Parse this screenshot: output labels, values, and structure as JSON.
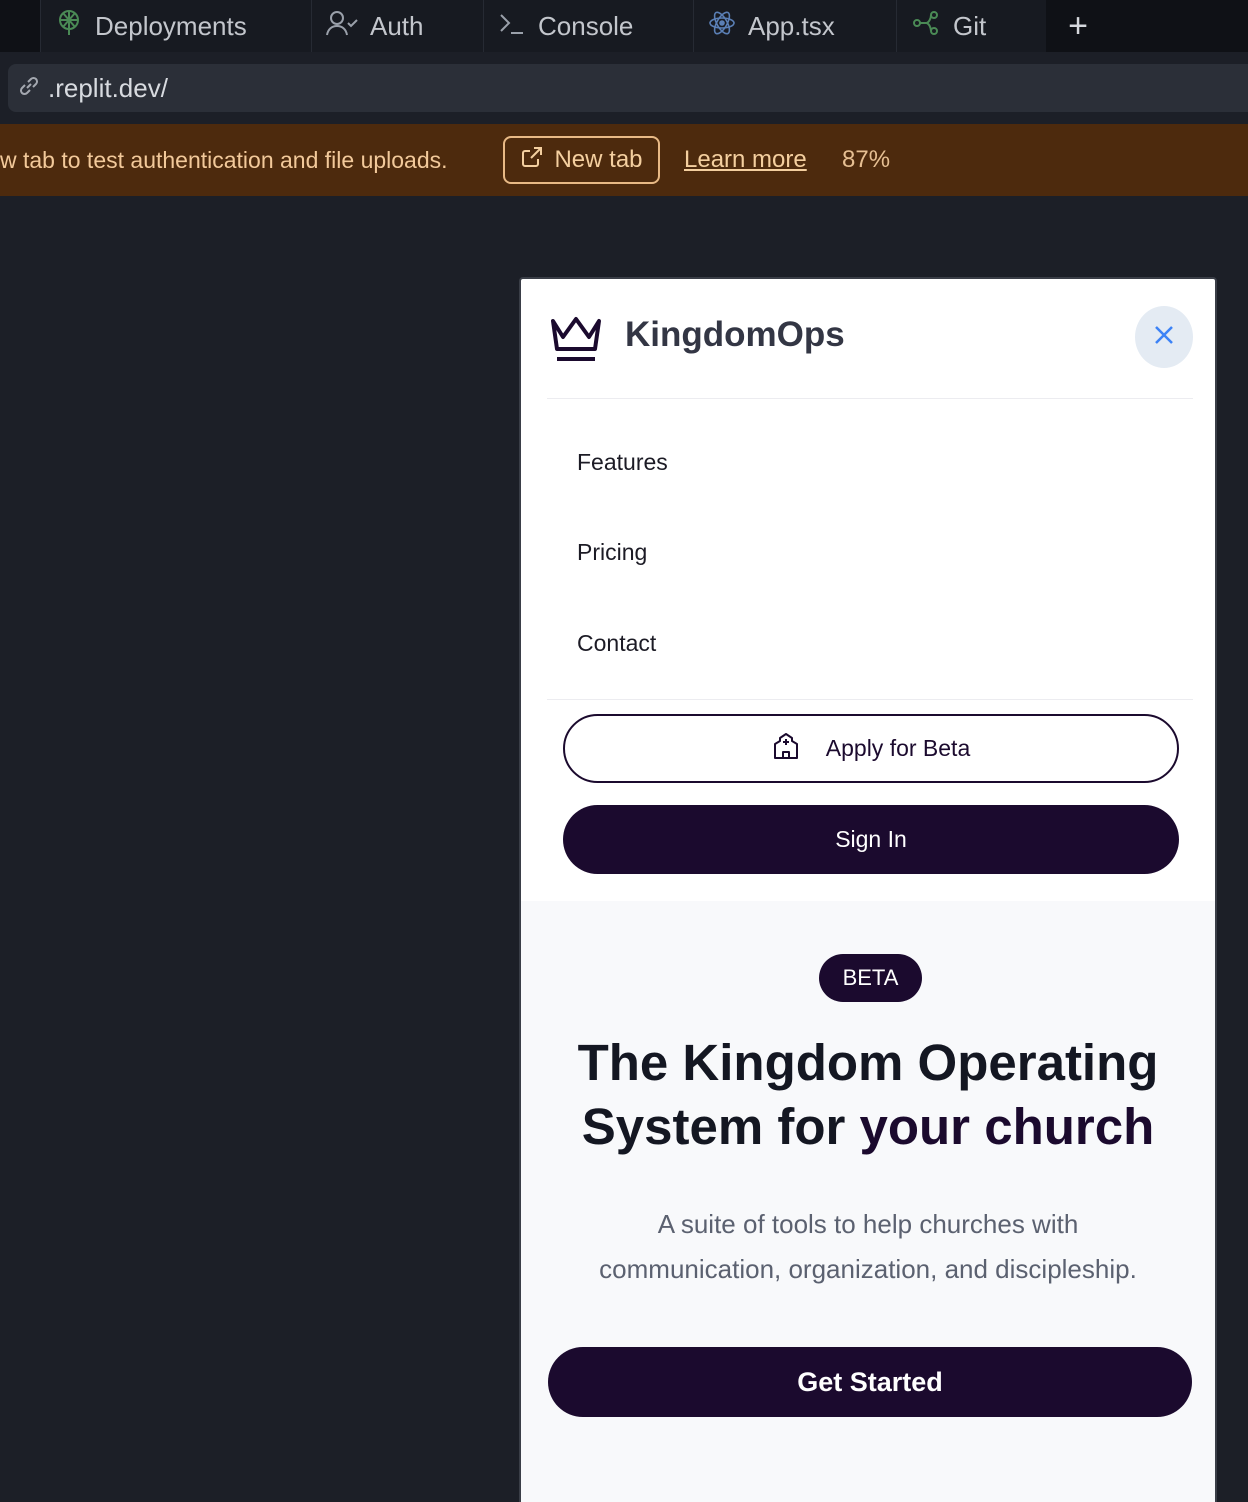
{
  "tabs": [
    {
      "label": "Deployments",
      "icon": "deployments-icon"
    },
    {
      "label": "Auth",
      "icon": "user-check-icon"
    },
    {
      "label": "Console",
      "icon": "terminal-icon"
    },
    {
      "label": "App.tsx",
      "icon": "react-icon"
    },
    {
      "label": "Git",
      "icon": "git-branch-icon"
    }
  ],
  "tab_add_label": "+",
  "url": {
    "text": ".replit.dev/",
    "icon": "link-icon"
  },
  "banner": {
    "message": "w tab to test authentication and file uploads.",
    "new_tab_label": "New tab",
    "learn_more_label": "Learn more",
    "zoom": "87%",
    "color": "#4d2a0d"
  },
  "app": {
    "brand": "KingdomOps",
    "accent_color": "#1b0a2e",
    "menu": [
      "Features",
      "Pricing",
      "Contact"
    ],
    "apply_label": "Apply for Beta",
    "signin_label": "Sign In",
    "hero": {
      "badge": "BETA",
      "title_line1": "The Kingdom Operating",
      "title_line2_plain": "System for ",
      "title_line2_accent": "your church",
      "subtitle_line1": "A suite of tools to help churches with",
      "subtitle_line2": "communication, organization, and discipleship.",
      "cta_label": "Get Started"
    }
  }
}
